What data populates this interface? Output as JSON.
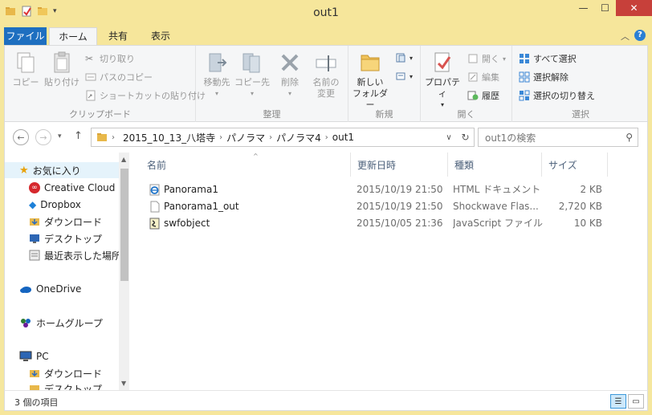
{
  "window": {
    "title": "out1"
  },
  "tabs": {
    "file": "ファイル",
    "home": "ホーム",
    "share": "共有",
    "view": "表示"
  },
  "ribbon": {
    "clipboard": {
      "label": "クリップボード",
      "copy": "コピー",
      "paste": "貼り付け",
      "cut": "切り取り",
      "copy_path": "パスのコピー",
      "paste_shortcut": "ショートカットの貼り付け"
    },
    "organize": {
      "label": "整理",
      "move_to": "移動先",
      "copy_to": "コピー先",
      "delete": "削除",
      "rename_line1": "名前の",
      "rename_line2": "変更"
    },
    "new": {
      "label": "新規",
      "new_folder_line1": "新しい",
      "new_folder_line2": "フォルダー"
    },
    "open": {
      "label": "開く",
      "properties": "プロパティ",
      "open": "開く",
      "edit": "編集",
      "history": "履歴"
    },
    "select": {
      "label": "選択",
      "select_all": "すべて選択",
      "select_none": "選択解除",
      "invert": "選択の切り替え"
    }
  },
  "address": {
    "crumbs": [
      "2015_10_13_八塔寺",
      "パノラマ",
      "パノラマ4",
      "out1"
    ],
    "search_placeholder": "out1の検索"
  },
  "nav": {
    "favorites": "お気に入り",
    "creative_cloud": "Creative Cloud",
    "dropbox": "Dropbox",
    "downloads": "ダウンロード",
    "desktop": "デスクトップ",
    "recent": "最近表示した場所",
    "onedrive": "OneDrive",
    "homegroup": "ホームグループ",
    "pc": "PC",
    "pc_downloads": "ダウンロード",
    "pc_desktop": "デスクトップ"
  },
  "columns": {
    "name": "名前",
    "date": "更新日時",
    "type": "種類",
    "size": "サイズ"
  },
  "files": [
    {
      "name": "Panorama1",
      "date": "2015/10/19 21:50",
      "type": "HTML ドキュメント",
      "size": "2 KB",
      "icon": "ie-html-icon"
    },
    {
      "name": "Panorama1_out",
      "date": "2015/10/19 21:50",
      "type": "Shockwave Flas...",
      "size": "2,720 KB",
      "icon": "blank-file-icon"
    },
    {
      "name": "swfobject",
      "date": "2015/10/05 21:36",
      "type": "JavaScript ファイル",
      "size": "10 KB",
      "icon": "js-file-icon"
    }
  ],
  "status": {
    "item_count": "3 個の項目"
  }
}
